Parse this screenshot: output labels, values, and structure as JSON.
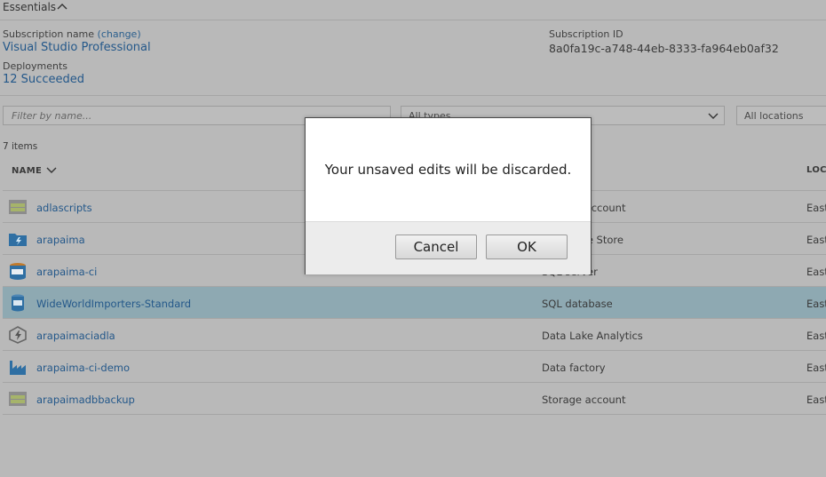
{
  "essentials": {
    "title": "Essentials"
  },
  "subscription": {
    "label": "Subscription name",
    "change": "(change)",
    "name": "Visual Studio Professional",
    "id_label": "Subscription ID",
    "id": "8a0fa19c-a748-44eb-8333-fa964eb0af32"
  },
  "deployments": {
    "label": "Deployments",
    "value": "12 Succeeded"
  },
  "filters": {
    "name_placeholder": "Filter by name...",
    "types": "All types",
    "locations": "All locations"
  },
  "item_count": "7 items",
  "columns": {
    "name": "NAME",
    "location": "LOCA"
  },
  "rows": [
    {
      "name": "adlascripts",
      "type": "Storage account",
      "location": "East",
      "icon": "storage-account-icon"
    },
    {
      "name": "arapaima",
      "type": "Data Lake Store",
      "location": "East",
      "icon": "data-lake-store-icon"
    },
    {
      "name": "arapaima-ci",
      "type": "SQL server",
      "location": "East",
      "icon": "sql-server-icon"
    },
    {
      "name": "WideWorldImporters-Standard",
      "type": "SQL database",
      "location": "East",
      "icon": "sql-database-icon"
    },
    {
      "name": "arapaimaciadla",
      "type": "Data Lake Analytics",
      "location": "East",
      "icon": "data-lake-analytics-icon"
    },
    {
      "name": "arapaima-ci-demo",
      "type": "Data factory",
      "location": "East",
      "icon": "data-factory-icon"
    },
    {
      "name": "arapaimadbbackup",
      "type": "Storage account",
      "location": "East",
      "icon": "storage-account-icon"
    }
  ],
  "dialog": {
    "message": "Your unsaved edits will be discarded.",
    "cancel": "Cancel",
    "ok": "OK"
  },
  "colors": {
    "link": "#24588a",
    "selected_row": "#8ea9b2",
    "overlay_gray": "#b9b9b9"
  }
}
